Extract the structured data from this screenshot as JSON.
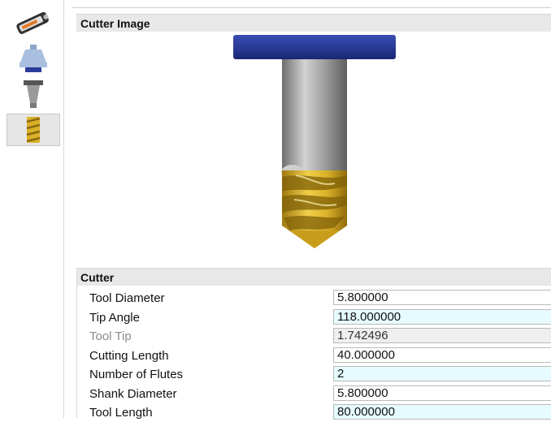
{
  "sidebar": {
    "tabs": [
      {
        "icon": "tag-icon"
      },
      {
        "icon": "holder-icon"
      },
      {
        "icon": "shank-icon"
      },
      {
        "icon": "drill-icon",
        "active": true
      }
    ]
  },
  "image_section": {
    "title": "Cutter Image"
  },
  "cutter_section": {
    "title": "Cutter",
    "properties": [
      {
        "label": "Tool Diameter",
        "value": "5.800000"
      },
      {
        "label": "Tip Angle",
        "value": "118.000000"
      },
      {
        "label": "Tool Tip",
        "value": "1.742496"
      },
      {
        "label": "Cutting Length",
        "value": "40.000000"
      },
      {
        "label": "Number of Flutes",
        "value": "2"
      },
      {
        "label": "Shank Diameter",
        "value": "5.800000"
      },
      {
        "label": "Tool Length",
        "value": "80.000000"
      }
    ]
  },
  "colors": {
    "holder_blue": "#2b3b9a",
    "flute_gold": "#d9b028",
    "shank_gray": "#9c9c9c",
    "tinted_field": "#e6fbff"
  }
}
